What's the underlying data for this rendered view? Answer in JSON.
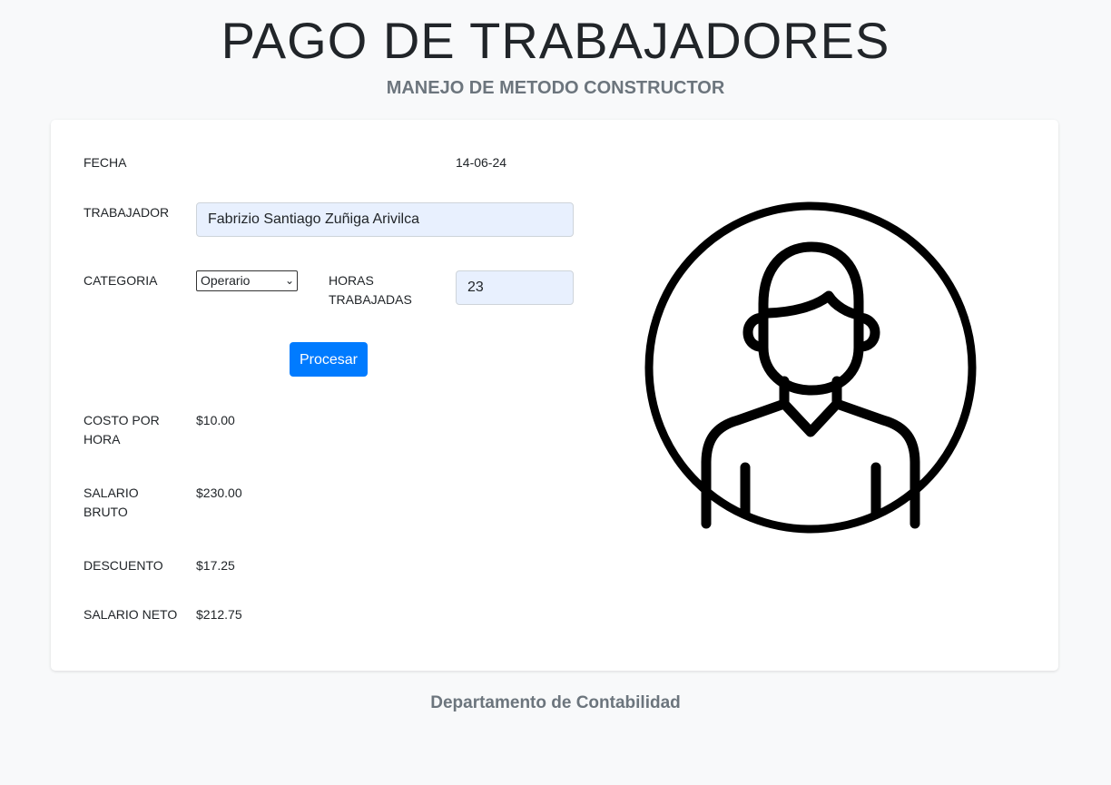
{
  "header": {
    "title": "PAGO DE TRABAJADORES",
    "subtitle": "MANEJO DE METODO CONSTRUCTOR"
  },
  "form": {
    "fecha_label": "FECHA",
    "fecha_value": "14-06-24",
    "trabajador_label": "TRABAJADOR",
    "trabajador_value": "Fabrizio Santiago Zuñiga Arivilca",
    "categoria_label": "CATEGORIA",
    "categoria_selected": "Operario",
    "horas_label_line1": "HORAS",
    "horas_label_line2": "TRABAJADAS",
    "horas_value": "23",
    "submit_label": "Procesar"
  },
  "results": {
    "costo_label_line1": "COSTO POR",
    "costo_label_line2": "HORA",
    "costo_value": "$10.00",
    "bruto_label_line1": "SALARIO",
    "bruto_label_line2": "BRUTO",
    "bruto_value": "$230.00",
    "descuento_label": "DESCUENTO",
    "descuento_value": "$17.25",
    "neto_label": "SALARIO NETO",
    "neto_value": "$212.75"
  },
  "avatar": {
    "icon": "user-avatar-icon"
  },
  "footer": {
    "text": "Departamento de Contabilidad"
  },
  "colors": {
    "accent": "#007bff",
    "background": "#f8f9fa",
    "card": "#ffffff",
    "input_fill": "#e8f0fe",
    "muted_text": "#6c757d"
  }
}
